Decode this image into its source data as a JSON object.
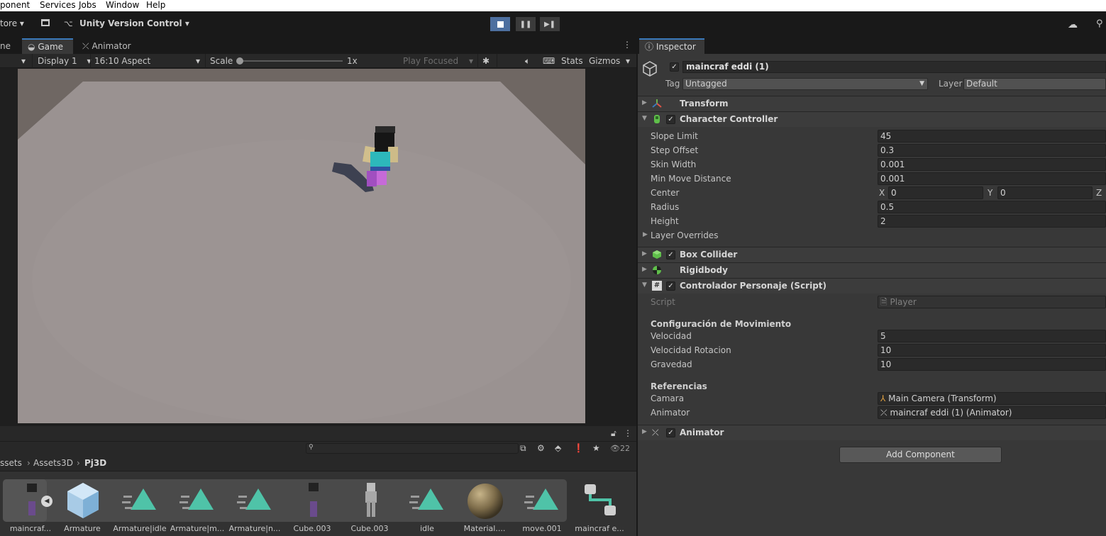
{
  "menubar": {
    "items": [
      "ponent",
      "Services",
      "Jobs",
      "Window",
      "Help"
    ]
  },
  "toolbar": {
    "store_label": "tore",
    "vc_label": "Unity Version Control"
  },
  "game_panel": {
    "tabs": [
      "ne",
      "Game",
      "Animator"
    ],
    "display": "Display 1",
    "aspect": "16:10 Aspect",
    "scale_label": "Scale",
    "scale_value": "1x",
    "play_mode": "Play Focused",
    "stats": "Stats",
    "gizmos": "Gizmos"
  },
  "project": {
    "count": "22",
    "breadcrumb": [
      "ssets",
      "Assets3D",
      "Pj3D"
    ],
    "assets": [
      {
        "label": "maincraf...",
        "kind": "prefab"
      },
      {
        "label": "Armature",
        "kind": "box"
      },
      {
        "label": "Armature|idle",
        "kind": "anim"
      },
      {
        "label": "Armature|m...",
        "kind": "anim"
      },
      {
        "label": "Armature|n...",
        "kind": "anim"
      },
      {
        "label": "Cube.003",
        "kind": "mesh"
      },
      {
        "label": "Cube.003",
        "kind": "skeleton"
      },
      {
        "label": "idle",
        "kind": "anim"
      },
      {
        "label": "Material....",
        "kind": "material"
      },
      {
        "label": "move.001",
        "kind": "anim"
      },
      {
        "label": "maincraf e...",
        "kind": "controller"
      }
    ]
  },
  "inspector": {
    "tab": "Inspector",
    "object_name": "maincraf eddi (1)",
    "tag_label": "Tag",
    "tag_value": "Untagged",
    "layer_label": "Layer",
    "layer_value": "Default",
    "transform": "Transform",
    "character_controller": {
      "title": "Character Controller",
      "slope_limit_label": "Slope Limit",
      "slope_limit": "45",
      "step_offset_label": "Step Offset",
      "step_offset": "0.3",
      "skin_width_label": "Skin Width",
      "skin_width": "0.001",
      "min_move_label": "Min Move Distance",
      "min_move": "0.001",
      "center_label": "Center",
      "center_x": "0",
      "center_y": "0",
      "radius_label": "Radius",
      "radius": "0.5",
      "height_label": "Height",
      "height": "2",
      "layer_overrides": "Layer Overrides",
      "x": "X",
      "y": "Y",
      "z": "Z"
    },
    "box_collider": "Box Collider",
    "rigidbody": "Rigidbody",
    "script_component": {
      "title": "Controlador Personaje (Script)",
      "script_label": "Script",
      "script_value": "Player",
      "section_movement": "Configuración de Movimiento",
      "velocidad_label": "Velocidad",
      "velocidad": "5",
      "rotacion_label": "Velocidad Rotacion",
      "rotacion": "10",
      "gravedad_label": "Gravedad",
      "gravedad": "10",
      "section_refs": "Referencias",
      "camara_label": "Camara",
      "camara": "Main Camera (Transform)",
      "animator_label": "Animator",
      "animator": "maincraf eddi (1) (Animator)"
    },
    "animator": "Animator",
    "add_component": "Add Component"
  },
  "colors": {
    "accent_blue": "#3a79bb",
    "play_active": "#4d6f9f",
    "anim_teal": "#4fc3a8"
  }
}
